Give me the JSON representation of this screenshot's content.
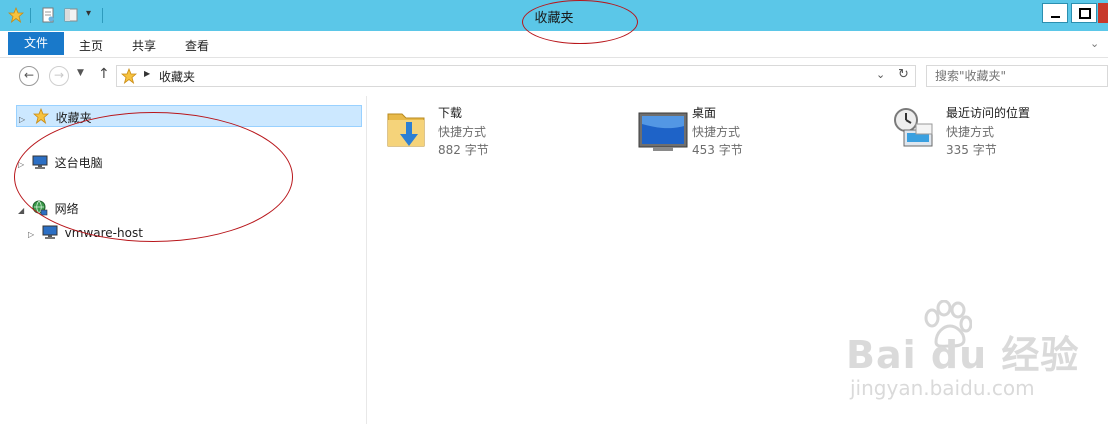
{
  "window": {
    "title": "收藏夹"
  },
  "ribbon": {
    "tabs": [
      "文件",
      "主页",
      "共享",
      "查看"
    ]
  },
  "address": {
    "path_label": "收藏夹",
    "search_placeholder": "搜索\"收藏夹\""
  },
  "tree": {
    "favorites": "收藏夹",
    "this_pc": "这台电脑",
    "network": "网络",
    "vmware_host": "vmware-host"
  },
  "items": [
    {
      "name": "下载",
      "type": "快捷方式",
      "size": "882 字节",
      "icon": "downloads-folder-icon"
    },
    {
      "name": "桌面",
      "type": "快捷方式",
      "size": "453 字节",
      "icon": "desktop-monitor-icon"
    },
    {
      "name": "最近访问的位置",
      "type": "快捷方式",
      "size": "335 字节",
      "icon": "recent-places-icon"
    }
  ],
  "watermark": {
    "brand": "Bai du 经验",
    "url": "jingyan.baidu.com"
  },
  "colors": {
    "titlebar": "#5bc7e8",
    "file_tab": "#1979ca",
    "selection": "#cce8ff",
    "annotation": "#b8161b"
  }
}
